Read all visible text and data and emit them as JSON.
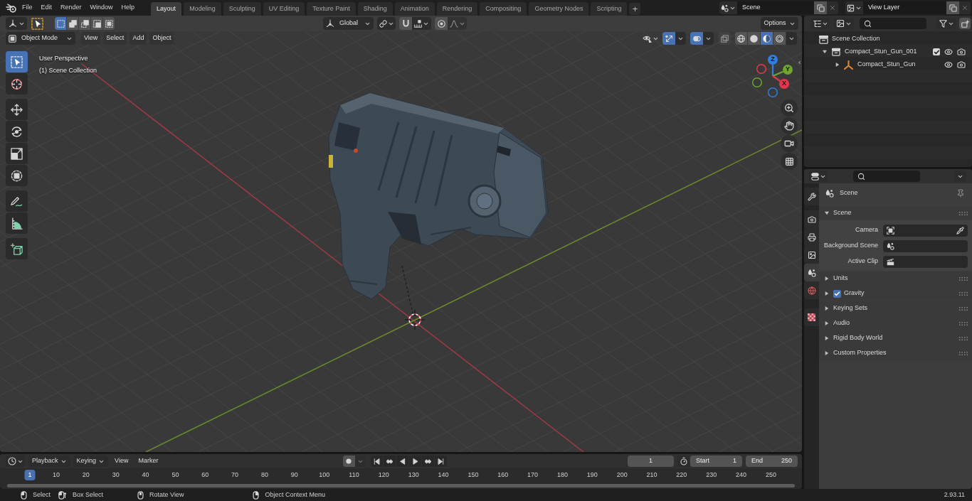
{
  "top_bar": {
    "menus": [
      "File",
      "Edit",
      "Render",
      "Window",
      "Help"
    ],
    "workspaces": [
      {
        "label": "Layout",
        "selected": true
      },
      {
        "label": "Modeling",
        "selected": false
      },
      {
        "label": "Sculpting",
        "selected": false
      },
      {
        "label": "UV Editing",
        "selected": false
      },
      {
        "label": "Texture Paint",
        "selected": false
      },
      {
        "label": "Shading",
        "selected": false
      },
      {
        "label": "Animation",
        "selected": false
      },
      {
        "label": "Rendering",
        "selected": false
      },
      {
        "label": "Compositing",
        "selected": false
      },
      {
        "label": "Geometry Nodes",
        "selected": false
      },
      {
        "label": "Scripting",
        "selected": false
      }
    ],
    "add_workspace": "+",
    "scene": "Scene",
    "view_layer": "View Layer"
  },
  "viewport": {
    "tool_header": {
      "selection_modes": [
        {
          "kind": "set",
          "selected": true
        },
        {
          "kind": "extend",
          "selected": false
        },
        {
          "kind": "subtract",
          "selected": false
        },
        {
          "kind": "invert",
          "selected": false
        },
        {
          "kind": "intersect",
          "selected": false
        }
      ],
      "orientation": "Global",
      "options": "Options"
    },
    "header": {
      "mode": "Object Mode",
      "menus": [
        "View",
        "Select",
        "Add",
        "Object"
      ],
      "gizmos_on": true,
      "overlays_on": true,
      "xray_on": false,
      "shading": [
        {
          "kind": "wireframe",
          "selected": false
        },
        {
          "kind": "solid",
          "selected": false
        },
        {
          "kind": "material",
          "selected": true
        },
        {
          "kind": "rendered",
          "selected": false
        }
      ]
    },
    "tools": [
      {
        "kind": "select_box",
        "selected": true
      },
      {
        "kind": "cursor",
        "selected": false
      },
      {
        "kind": "move",
        "selected": false
      },
      {
        "kind": "rotate",
        "selected": false
      },
      {
        "kind": "scale",
        "selected": false
      },
      {
        "kind": "transform",
        "selected": false
      },
      {
        "kind": "annotate",
        "selected": false
      },
      {
        "kind": "measure",
        "selected": false
      },
      {
        "kind": "add_cube",
        "selected": false
      }
    ],
    "info": [
      "User Perspective",
      "(1) Scene Collection"
    ],
    "axes": [
      {
        "label": "Z",
        "color": "#2f7fe0"
      },
      {
        "label": "Y",
        "color": "#6ea52c"
      },
      {
        "label": "X",
        "color": "#e6364e"
      }
    ]
  },
  "outliner": {
    "items": [
      {
        "label": "Scene Collection",
        "kind": "scene_collection",
        "children": [
          {
            "label": "Compact_Stun_Gun_001",
            "kind": "collection",
            "expanded": true,
            "checked": true,
            "children": [
              {
                "label": "Compact_Stun_Gun",
                "kind": "empty",
                "expanded": false
              }
            ]
          }
        ]
      }
    ]
  },
  "properties": {
    "tabs": [
      {
        "kind": "tool",
        "selected": false
      },
      {
        "kind": "render",
        "selected": false
      },
      {
        "kind": "output",
        "selected": false
      },
      {
        "kind": "view_layer",
        "selected": false
      },
      {
        "kind": "scene",
        "selected": true
      },
      {
        "kind": "world",
        "selected": false
      },
      {
        "kind": "texture",
        "selected": false
      }
    ],
    "breadcrumb": "Scene",
    "panels": [
      {
        "label": "Scene",
        "expanded": true,
        "fields": [
          {
            "label": "Camera",
            "kind": "camera"
          },
          {
            "label": "Background Scene",
            "kind": "scene"
          },
          {
            "label": "Active Clip",
            "kind": "clip"
          }
        ]
      },
      {
        "label": "Units",
        "expanded": false
      },
      {
        "label": "Gravity",
        "expanded": false,
        "checked": true
      },
      {
        "label": "Keying Sets",
        "expanded": false
      },
      {
        "label": "Audio",
        "expanded": false
      },
      {
        "label": "Rigid Body World",
        "expanded": false
      },
      {
        "label": "Custom Properties",
        "expanded": false
      }
    ]
  },
  "timeline": {
    "menus": [
      {
        "label": "Playback",
        "kind": "dropdown"
      },
      {
        "label": "Keying",
        "kind": "dropdown"
      },
      {
        "label": "View",
        "kind": "menu"
      },
      {
        "label": "Marker",
        "kind": "menu"
      }
    ],
    "current_frame": "1",
    "start_label": "Start",
    "start": "1",
    "end_label": "End",
    "end": "250",
    "ruler": [
      {
        "label": "1",
        "selected": true
      },
      {
        "label": "10",
        "selected": false
      },
      {
        "label": "20",
        "selected": false
      },
      {
        "label": "30",
        "selected": false
      },
      {
        "label": "40",
        "selected": false
      },
      {
        "label": "50",
        "selected": false
      },
      {
        "label": "60",
        "selected": false
      },
      {
        "label": "70",
        "selected": false
      },
      {
        "label": "80",
        "selected": false
      },
      {
        "label": "90",
        "selected": false
      },
      {
        "label": "100",
        "selected": false
      },
      {
        "label": "110",
        "selected": false
      },
      {
        "label": "120",
        "selected": false
      },
      {
        "label": "130",
        "selected": false
      },
      {
        "label": "140",
        "selected": false
      },
      {
        "label": "150",
        "selected": false
      },
      {
        "label": "160",
        "selected": false
      },
      {
        "label": "170",
        "selected": false
      },
      {
        "label": "180",
        "selected": false
      },
      {
        "label": "190",
        "selected": false
      },
      {
        "label": "200",
        "selected": false
      },
      {
        "label": "210",
        "selected": false
      },
      {
        "label": "220",
        "selected": false
      },
      {
        "label": "230",
        "selected": false
      },
      {
        "label": "240",
        "selected": false
      },
      {
        "label": "250",
        "selected": false
      }
    ]
  },
  "status_bar": {
    "hints": [
      {
        "kind": "mouse_left",
        "label": "Select"
      },
      {
        "kind": "mouse_drag",
        "label": "Box Select"
      },
      {
        "kind": "mouse_middle",
        "label": "Rotate View"
      },
      {
        "kind": "mouse_right",
        "label": "Object Context Menu"
      }
    ],
    "version": "2.93.11"
  }
}
